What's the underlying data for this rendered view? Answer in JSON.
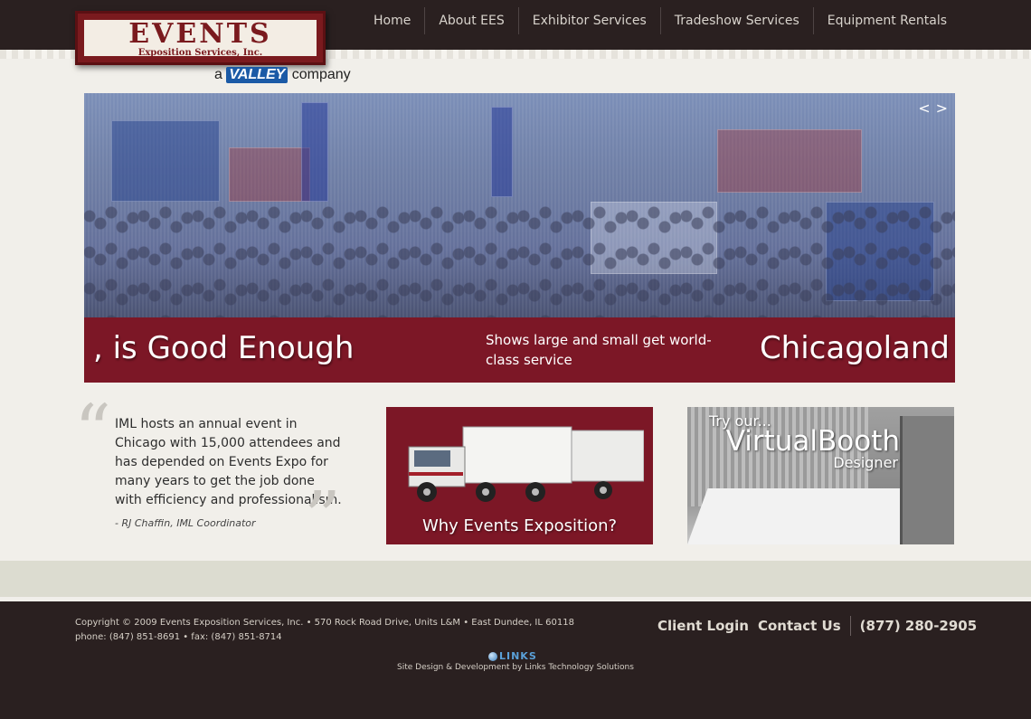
{
  "logo": {
    "title": "EVENTS",
    "subtitle": "Exposition Services, Inc.",
    "tagline_pre": "a",
    "tagline_brand": "VALLEY",
    "tagline_post": "company"
  },
  "nav": {
    "items": [
      "Home",
      "About EES",
      "Exhibitor Services",
      "Tradeshow Services",
      "Equipment Rentals"
    ]
  },
  "slider": {
    "arrow_prev": "<",
    "arrow_next": ">",
    "caption_left": ", is Good Enough",
    "caption_middle": "Shows large and small get world-class service",
    "caption_right": "Chicagoland"
  },
  "testimonial": {
    "open_mark": "“",
    "close_mark": "”",
    "text": "IML hosts an annual event in Chicago with 15,000 attendees and has depended on Events Expo for many years to get the job done with efficiency and professionalism.",
    "author": "- RJ Chaffin, IML Coordinator"
  },
  "promos": {
    "why_label": "Why Events Exposition?",
    "vb_pre": "Try our...",
    "vb_title": "VirtualBooth",
    "vb_post": "Designer"
  },
  "footer": {
    "copyright": "Copyright © 2009 Events Exposition Services, Inc. • 570 Rock Road Drive, Units L&M • East Dundee, IL 60118",
    "contact_line": "phone: (847) 851-8691 • fax: (847) 851-8714",
    "client_login": "Client Login",
    "contact_us": "Contact Us",
    "phone": "(877) 280-2905",
    "links_logo": "LINKS",
    "credits": "Site Design & Development by Links Technology Solutions"
  },
  "colors": {
    "header_bg": "#2a2020",
    "maroon": "#7c1726",
    "paper": "#f1efea",
    "valley_blue": "#1b5aa6"
  }
}
